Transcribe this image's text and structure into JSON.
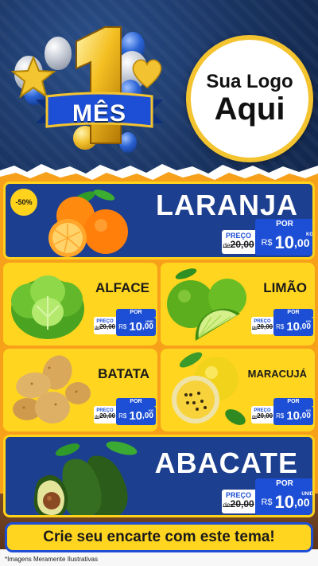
{
  "header": {
    "badge_number": "1",
    "badge_ribbon": "MÊS",
    "logo_line1": "Sua Logo",
    "logo_line2": "Aqui"
  },
  "colors": {
    "header_bg": "#1a3563",
    "body_bg": "#f7a11b",
    "card_blue": "#1d3f8f",
    "card_yellow": "#ffd51f",
    "price_blue": "#1d4fd6",
    "accent_gold": "#f4c430"
  },
  "products": [
    {
      "name": "LARANJA",
      "discount": "-50%",
      "icon": "orange-fruit-icon",
      "por": "POR",
      "preco_label": "PREÇO",
      "de": "de",
      "old_price": "20,00",
      "currency": "R$",
      "price_int": "10",
      "price_dec": ",00",
      "unit": "KG"
    },
    {
      "name": "ALFACE",
      "icon": "lettuce-icon",
      "por": "POR",
      "preco_label": "PREÇO",
      "de": "de",
      "old_price": "20,00",
      "currency": "R$",
      "price_int": "10",
      "price_dec": ",00",
      "unit": "UNID"
    },
    {
      "name": "LIMÃO",
      "icon": "lime-icon",
      "por": "POR",
      "preco_label": "PREÇO",
      "de": "de",
      "old_price": "20,00",
      "currency": "R$",
      "price_int": "10",
      "price_dec": ",00",
      "unit": "KG"
    },
    {
      "name": "BATATA",
      "icon": "potato-icon",
      "por": "POR",
      "preco_label": "PREÇO",
      "de": "de",
      "old_price": "20,00",
      "currency": "R$",
      "price_int": "10",
      "price_dec": ",00",
      "unit": "KG"
    },
    {
      "name": "MARACUJÁ",
      "icon": "passion-fruit-icon",
      "por": "POR",
      "preco_label": "PREÇO",
      "de": "de",
      "old_price": "20,00",
      "currency": "R$",
      "price_int": "10",
      "price_dec": ",00",
      "unit": "KG"
    },
    {
      "name": "ABACATE",
      "icon": "avocado-icon",
      "por": "POR",
      "preco_label": "PREÇO",
      "de": "de",
      "old_price": "20,00",
      "currency": "R$",
      "price_int": "10",
      "price_dec": ",00",
      "unit": "UNID"
    }
  ],
  "cta": "Crie seu encarte com este tema!",
  "footnote": "*Imagens Meramente Ilustrativas"
}
